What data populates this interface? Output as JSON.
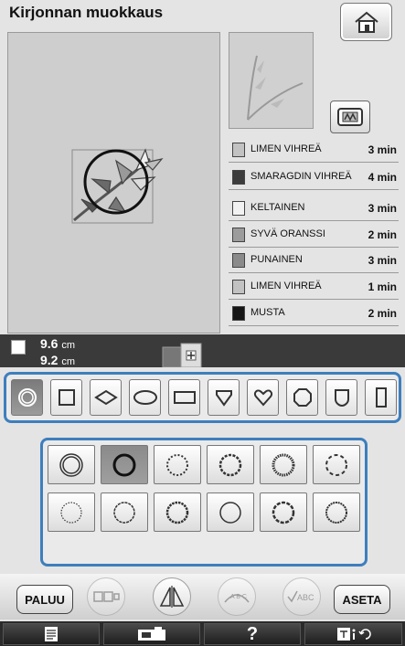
{
  "header": {
    "title": "Kirjonnan muokkaus"
  },
  "threads": [
    {
      "name": "LIMEN VIHREÄ",
      "time": "3 min",
      "color": "#c2c2c2"
    },
    {
      "name": "SMARAGDIN VIHREÄ",
      "time": "4 min",
      "color": "#3c3c3c"
    },
    {
      "name": "KELTAINEN",
      "time": "3 min",
      "color": "#f2f2f2"
    },
    {
      "name": "SYVÄ ORANSSI",
      "time": "2 min",
      "color": "#9c9c9c"
    },
    {
      "name": "PUNAINEN",
      "time": "3 min",
      "color": "#8a8a8a"
    },
    {
      "name": "LIMEN VIHREÄ",
      "time": "1 min",
      "color": "#c2c2c2"
    },
    {
      "name": "MUSTA",
      "time": "2 min",
      "color": "#151515"
    }
  ],
  "size": {
    "width": "9.6",
    "height": "9.2",
    "unit": "cm"
  },
  "shapes": [
    "circle",
    "square",
    "diamond",
    "oval",
    "rectangle",
    "shield",
    "heart",
    "octagon",
    "badge",
    "tall-rectangle"
  ],
  "styles": [
    "double-ring",
    "bold-ring",
    "fine-dotted-ring",
    "bead-ring",
    "dense-bead-ring",
    "dashed-ring",
    "thin-dotted-ring",
    "scalloped-ring",
    "wavy-bead-ring",
    "plain-ring",
    "sparse-bead-ring",
    "zigzag-ring"
  ],
  "actions": {
    "back_label": "PALUU",
    "set_label": "ASETA"
  },
  "tabs": {
    "help_label": "?"
  },
  "colors": {
    "accent": "#3d7fbd",
    "dark_bar": "#3a3a3a"
  }
}
